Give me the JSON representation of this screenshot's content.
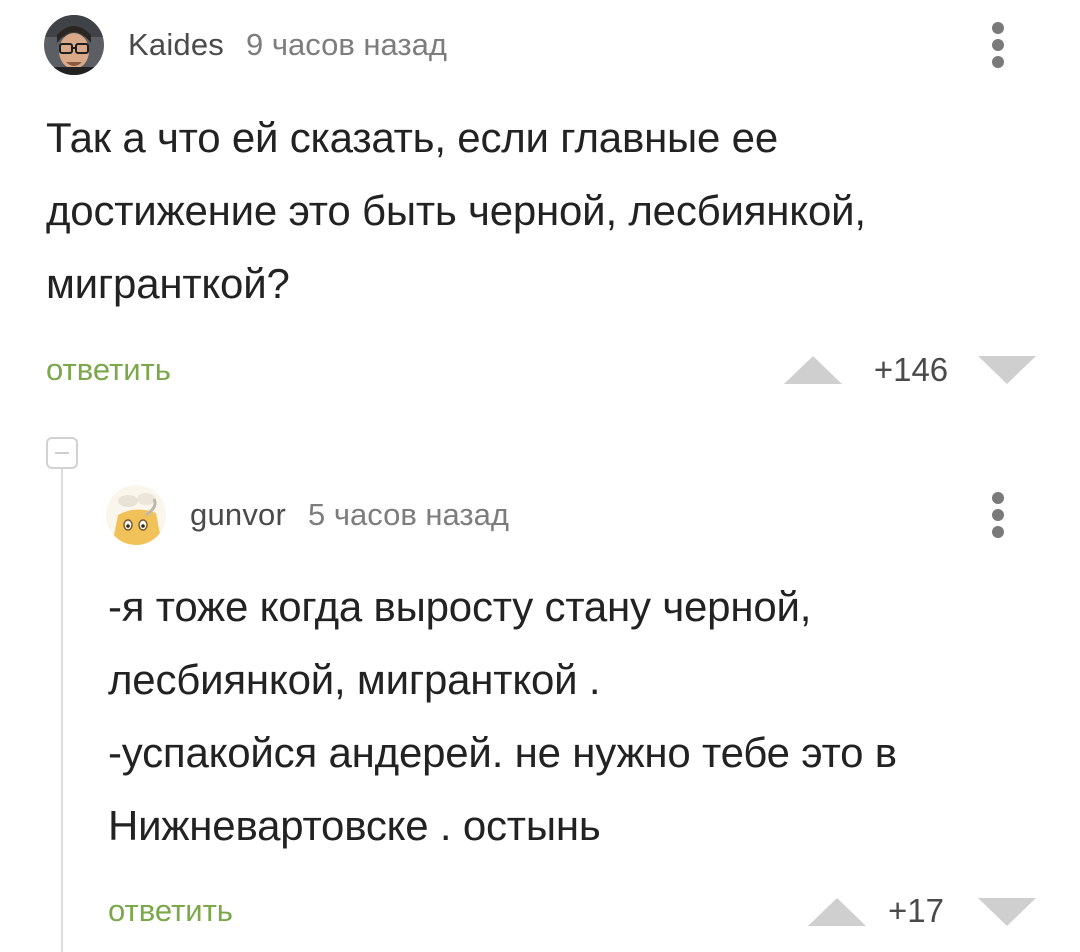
{
  "comments": [
    {
      "author": "Kaides",
      "time": "9 часов назад",
      "text": "Так а что ей сказать, если главные ее\nдостижение это быть черной, лесбиянкой,\nмигранткой?",
      "reply_label": "ответить",
      "rating": "+146",
      "avatar_icon": "user-avatar-photo",
      "menu_icon": "more-vertical-icon"
    },
    {
      "author": "gunvor",
      "time": "5 часов назад",
      "text": "-я тоже когда выросту стану черной,\nлесбиянкой, мигранткой .\n-успакойся андерей. не нужно тебе это в\nНижневартовске . остынь",
      "reply_label": "ответить",
      "rating": "+17",
      "avatar_icon": "user-avatar-cartoon",
      "menu_icon": "more-vertical-icon"
    }
  ],
  "colors": {
    "reply": "#7aa84a",
    "vote_arrow": "#cfcfcf",
    "text": "#222222",
    "meta": "#7d7d7d"
  },
  "icons": {
    "collapse": "collapse-minus-icon",
    "vote_up": "arrow-up-triangle-icon",
    "vote_down": "arrow-down-triangle-icon"
  }
}
